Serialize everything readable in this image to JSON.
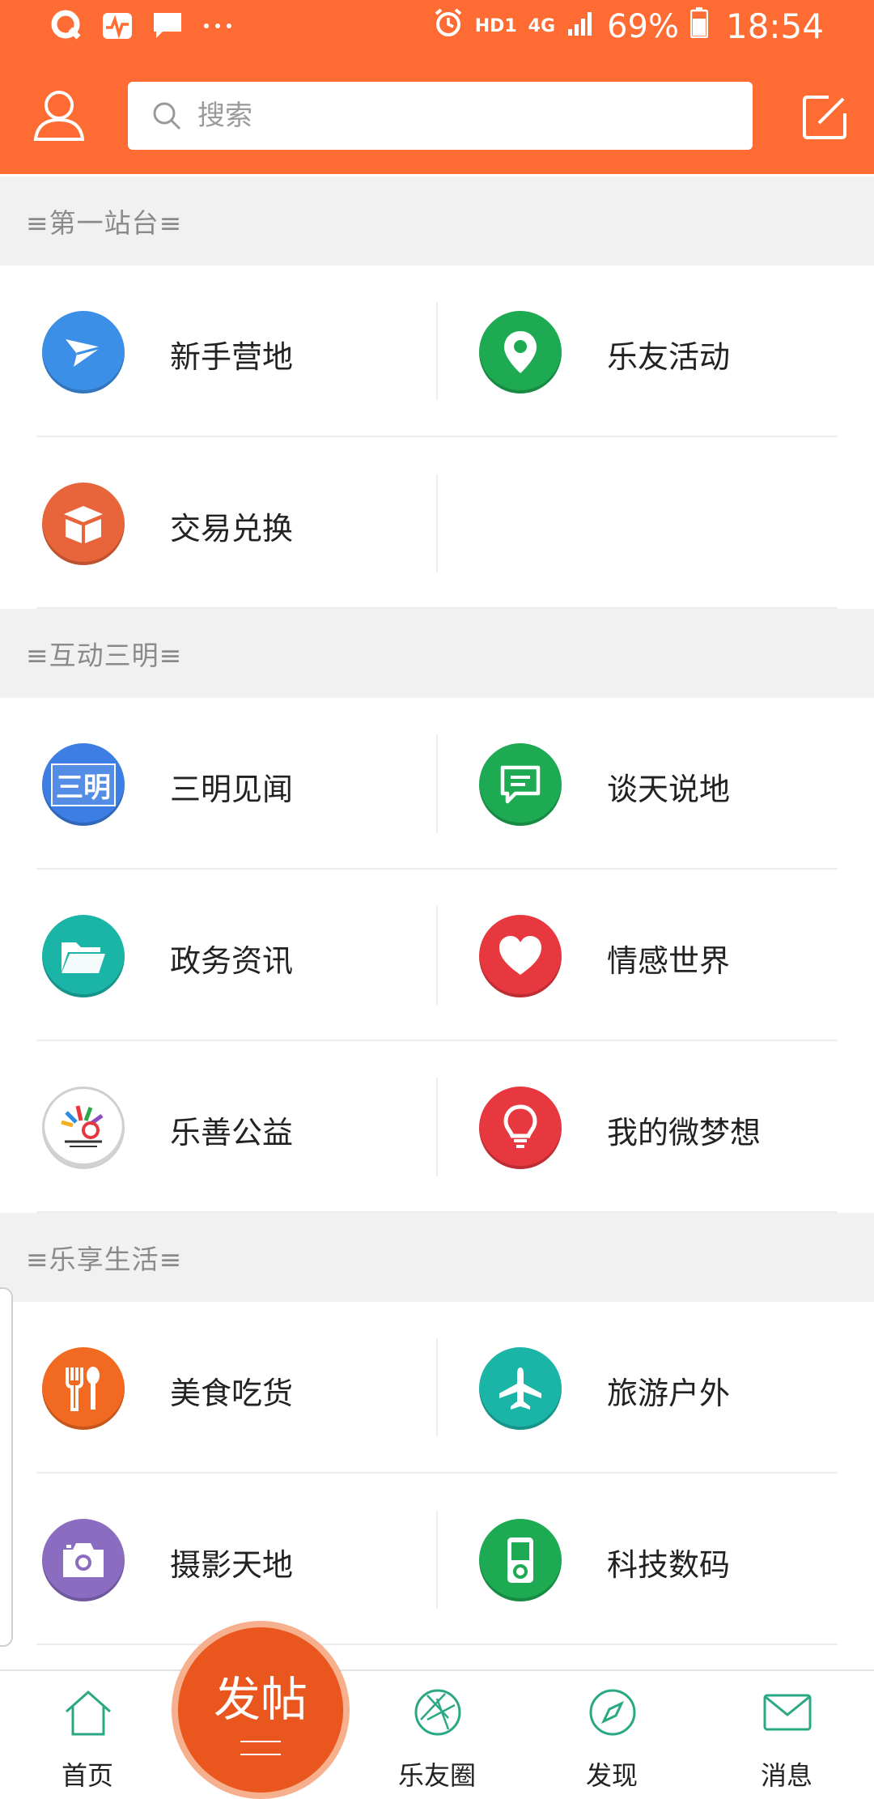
{
  "status_bar": {
    "network_label": "HD1",
    "signal_label": "4G",
    "battery": "69%",
    "time": "18:54"
  },
  "search": {
    "placeholder": "搜索"
  },
  "sections": [
    {
      "title": "≡第一站台≡",
      "rows": [
        [
          {
            "label": "新手营地",
            "icon": "paper-plane-icon",
            "color": "#3c8fe6"
          },
          {
            "label": "乐友活动",
            "icon": "location-pin-icon",
            "color": "#1eaa52"
          }
        ],
        [
          {
            "label": "交易兑换",
            "icon": "open-box-icon",
            "color": "#e8643a"
          }
        ]
      ]
    },
    {
      "title": "≡互动三明≡",
      "rows": [
        [
          {
            "label": "三明见闻",
            "icon": "sanming-logo-icon",
            "color": "#3c7ee3",
            "badge": "三明"
          },
          {
            "label": "谈天说地",
            "icon": "chat-bubble-icon",
            "color": "#1eaa52"
          }
        ],
        [
          {
            "label": "政务资讯",
            "icon": "folder-icon",
            "color": "#1bb5a8"
          },
          {
            "label": "情感世界",
            "icon": "heart-icon",
            "color": "#e8383f"
          }
        ],
        [
          {
            "label": "乐善公益",
            "icon": "charity-logo-icon",
            "color": "#ffffff"
          },
          {
            "label": "我的微梦想",
            "icon": "lightbulb-icon",
            "color": "#e8383f"
          }
        ]
      ]
    },
    {
      "title": "≡乐享生活≡",
      "rows": [
        [
          {
            "label": "美食吃货",
            "icon": "fork-spoon-icon",
            "color": "#f26a22"
          },
          {
            "label": "旅游户外",
            "icon": "airplane-icon",
            "color": "#1bb5a8"
          }
        ],
        [
          {
            "label": "摄影天地",
            "icon": "camera-icon",
            "color": "#8a6cc0"
          },
          {
            "label": "科技数码",
            "icon": "mp3-player-icon",
            "color": "#1eaa52"
          }
        ]
      ]
    }
  ],
  "bottom_nav": {
    "home": "首页",
    "post": "发帖",
    "circle": "乐友圈",
    "discover": "发现",
    "messages": "消息"
  },
  "colors": {
    "accent": "#fe6b33",
    "post_button": "#e9561e"
  }
}
